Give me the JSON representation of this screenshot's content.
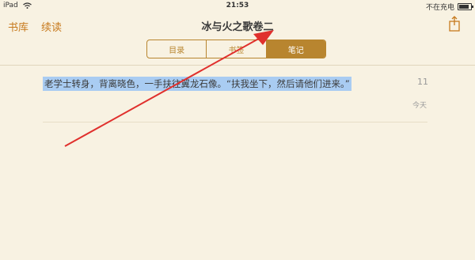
{
  "status_bar": {
    "device": "iPad",
    "time": "21:53",
    "charge_status": "不在充电",
    "battery_level": 0.85
  },
  "nav": {
    "library": "书库",
    "continue": "续读",
    "title": "冰与火之歌卷二"
  },
  "tabs": [
    {
      "label": "目录",
      "active": false
    },
    {
      "label": "书签",
      "active": false
    },
    {
      "label": "笔记",
      "active": true
    }
  ],
  "note": {
    "text": "老学士转身，背离晓色，一手扶往翼龙石像。“扶我坐下，然后请他们进来。”",
    "date": "11",
    "day": "今天"
  },
  "colors": {
    "accent": "#c77a1e",
    "segment": "#b8852f",
    "highlight": "#a9ccf2",
    "background": "#f8f2e2",
    "annotation_arrow": "#e0302d"
  }
}
